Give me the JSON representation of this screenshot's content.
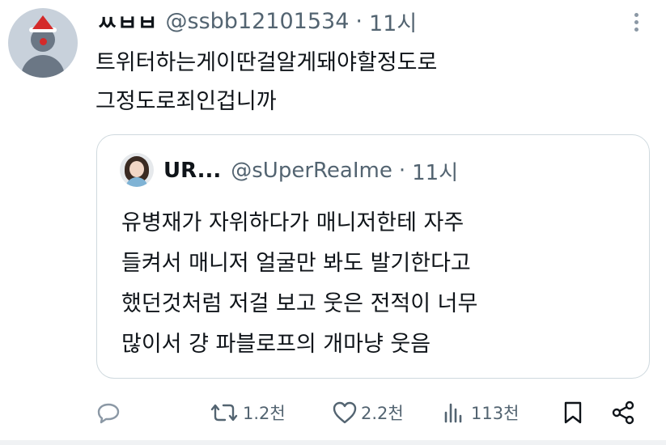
{
  "tweet": {
    "display_name": "ㅆㅂㅂ",
    "handle": "@ssbb12101534",
    "separator": "·",
    "time": "11시",
    "text_lines": [
      "트위터하는게이딴걸알게돼야할정도로",
      "그정도로죄인겁니까"
    ]
  },
  "quoted_tweet": {
    "display_name": "UR...",
    "handle": "@sUperReaIme",
    "separator": "·",
    "time": "11시",
    "text_lines": [
      "유병재가 자위하다가 매니저한테 자주",
      "들켜서 매니저 얼굴만 봐도 발기한다고",
      "했던것처럼 저걸 보고 웃은 전적이 너무",
      "많이서 걍 파블로프의 개마냥 웃음"
    ]
  },
  "actions": {
    "reply": {
      "icon": "reply-icon"
    },
    "retweet": {
      "icon": "retweet-icon",
      "count": "1.2천"
    },
    "like": {
      "icon": "heart-icon",
      "count": "2.2천"
    },
    "views": {
      "icon": "views-icon",
      "count": "113천"
    },
    "bookmark": {
      "icon": "bookmark-icon"
    },
    "share": {
      "icon": "share-icon"
    }
  },
  "colors": {
    "text": "#0f1419",
    "secondary": "#536471",
    "border": "#cfd9de"
  }
}
